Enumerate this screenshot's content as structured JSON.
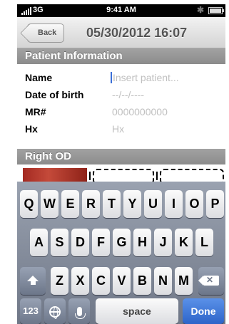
{
  "status_bar": {
    "carrier": "3G",
    "time": "9:41 AM",
    "bluetooth_icon": "bluetooth-icon",
    "battery_icon": "battery-icon"
  },
  "nav": {
    "back_label": "Back",
    "title": "05/30/2012 16:07"
  },
  "sections": {
    "patient_info": "Patient Information",
    "right_od": "Right OD"
  },
  "form": {
    "name": {
      "label": "Name",
      "placeholder": "Insert patient..."
    },
    "dob": {
      "label": "Date of birth",
      "placeholder": "--/--/----"
    },
    "mr": {
      "label": "MR#",
      "placeholder": "0000000000"
    },
    "hx": {
      "label": "Hx",
      "placeholder": "Hx"
    }
  },
  "keyboard": {
    "row1": [
      "Q",
      "W",
      "E",
      "R",
      "T",
      "Y",
      "U",
      "I",
      "O",
      "P"
    ],
    "row2": [
      "A",
      "S",
      "D",
      "F",
      "G",
      "H",
      "J",
      "K",
      "L"
    ],
    "row3": [
      "Z",
      "X",
      "C",
      "V",
      "B",
      "N",
      "M"
    ],
    "numbers_label": "123",
    "space_label": "space",
    "done_label": "Done",
    "shift_icon": "shift-icon",
    "delete_icon": "delete-icon",
    "globe_icon": "globe-icon",
    "mic_icon": "microphone-icon"
  },
  "colors": {
    "done_key": "#2d64c9",
    "section_header": "#8b8b8b",
    "placeholder_text": "#c0c0c0",
    "cursor": "#3a6fd8"
  }
}
